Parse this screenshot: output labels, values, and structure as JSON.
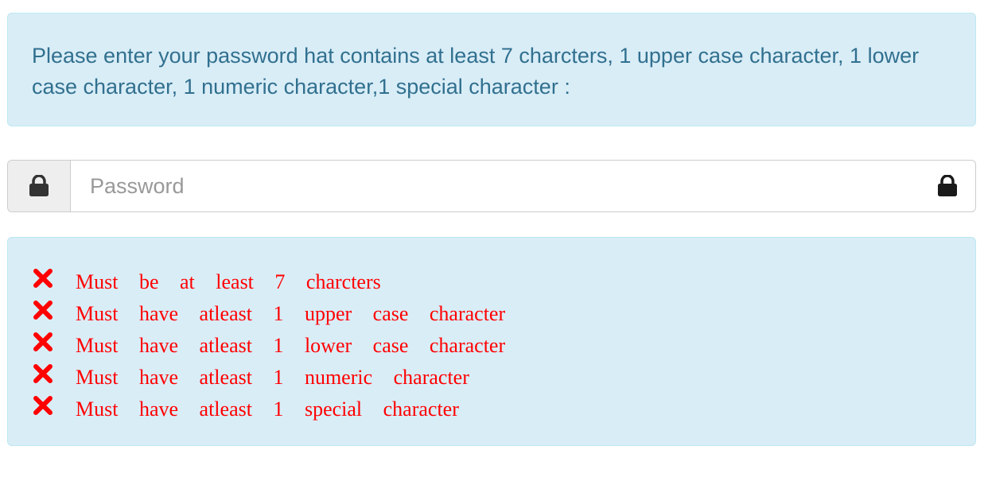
{
  "info": {
    "message": "Please enter your password hat contains at least 7 charcters, 1 upper case character, 1 lower case character, 1 numeric character,1 special character :"
  },
  "password": {
    "placeholder": "Password",
    "value": ""
  },
  "icons": {
    "addon": "lock-icon",
    "toggle": "lock-icon",
    "rule_status": "x-icon"
  },
  "colors": {
    "info_background": "#d9edf7",
    "info_border": "#bce8f1",
    "info_text": "#31708f",
    "rule_invalid": "#ff0000"
  },
  "rules": [
    {
      "text": "Must be at least 7 charcters",
      "met": false
    },
    {
      "text": "Must have atleast 1 upper case character",
      "met": false
    },
    {
      "text": "Must have atleast 1 lower case character",
      "met": false
    },
    {
      "text": "Must have atleast 1 numeric character",
      "met": false
    },
    {
      "text": "Must have atleast 1 special character",
      "met": false
    }
  ]
}
